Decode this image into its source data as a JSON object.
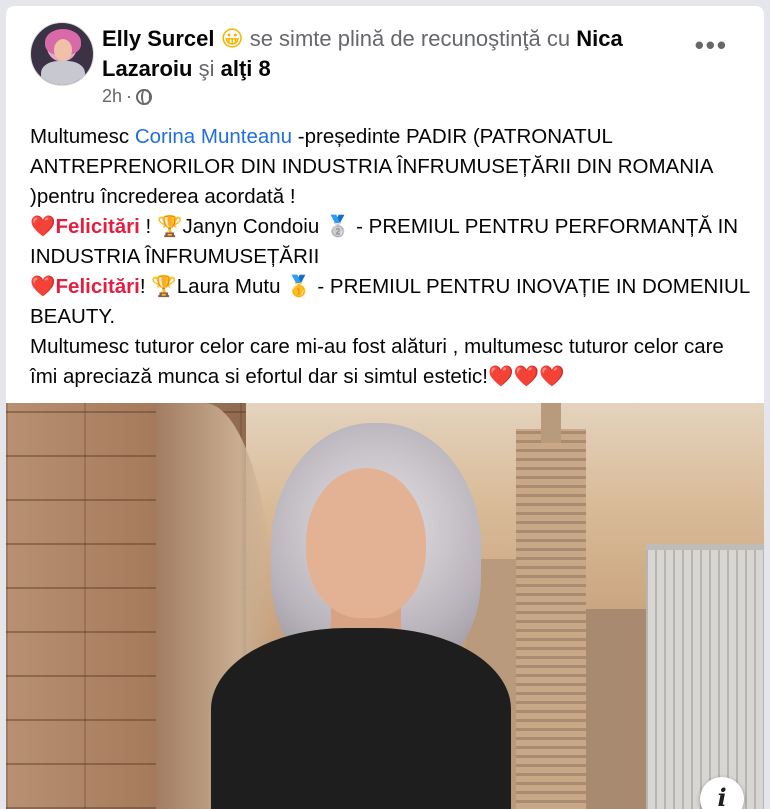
{
  "post": {
    "author": "Elly Surcel",
    "feeling_emoji": "😀",
    "feeling_text": "se simte plină de recunoştinţă cu",
    "tagged_person": "Nica Lazaroiu",
    "and_text": "şi",
    "others": "alţi 8",
    "time": "2h",
    "time_separator": "·",
    "more_label": "•••",
    "text": {
      "l1_a": "Multumesc ",
      "l1_link": "Corina Munteanu",
      "l1_b": " -președinte PADIR (PATRONATUL ANTREPRENORILOR DIN INDUSTRIA ÎNFRUMUSEȚĂRII DIN ROMANIA )pentru încrederea acordată !",
      "heart": "❤️",
      "felicitari1": "Felicitări",
      "p2_a": " ! ",
      "trophy": "🏆",
      "p2_name": "Janyn Condoiu ",
      "medal1": "🥈",
      "p2_b": " - PREMIUL PENTRU PERFORMANȚĂ IN INDUSTRIA ÎNFRUMUSEȚĂRII",
      "felicitari2": "Felicitări",
      "p3_a": "! ",
      "p3_name": "Laura Mutu ",
      "medal2": "🥇",
      "p3_b": " - PREMIUL PENTRU INOVAȚIE IN DOMENIUL BEAUTY.",
      "p4": "Multumesc tuturor celor care mi-au fost alături , multumesc tuturor celor care îmi apreciază munca si efortul dar si simtul estetic!",
      "hearts": "❤️❤️❤️"
    },
    "info_icon": "i"
  }
}
